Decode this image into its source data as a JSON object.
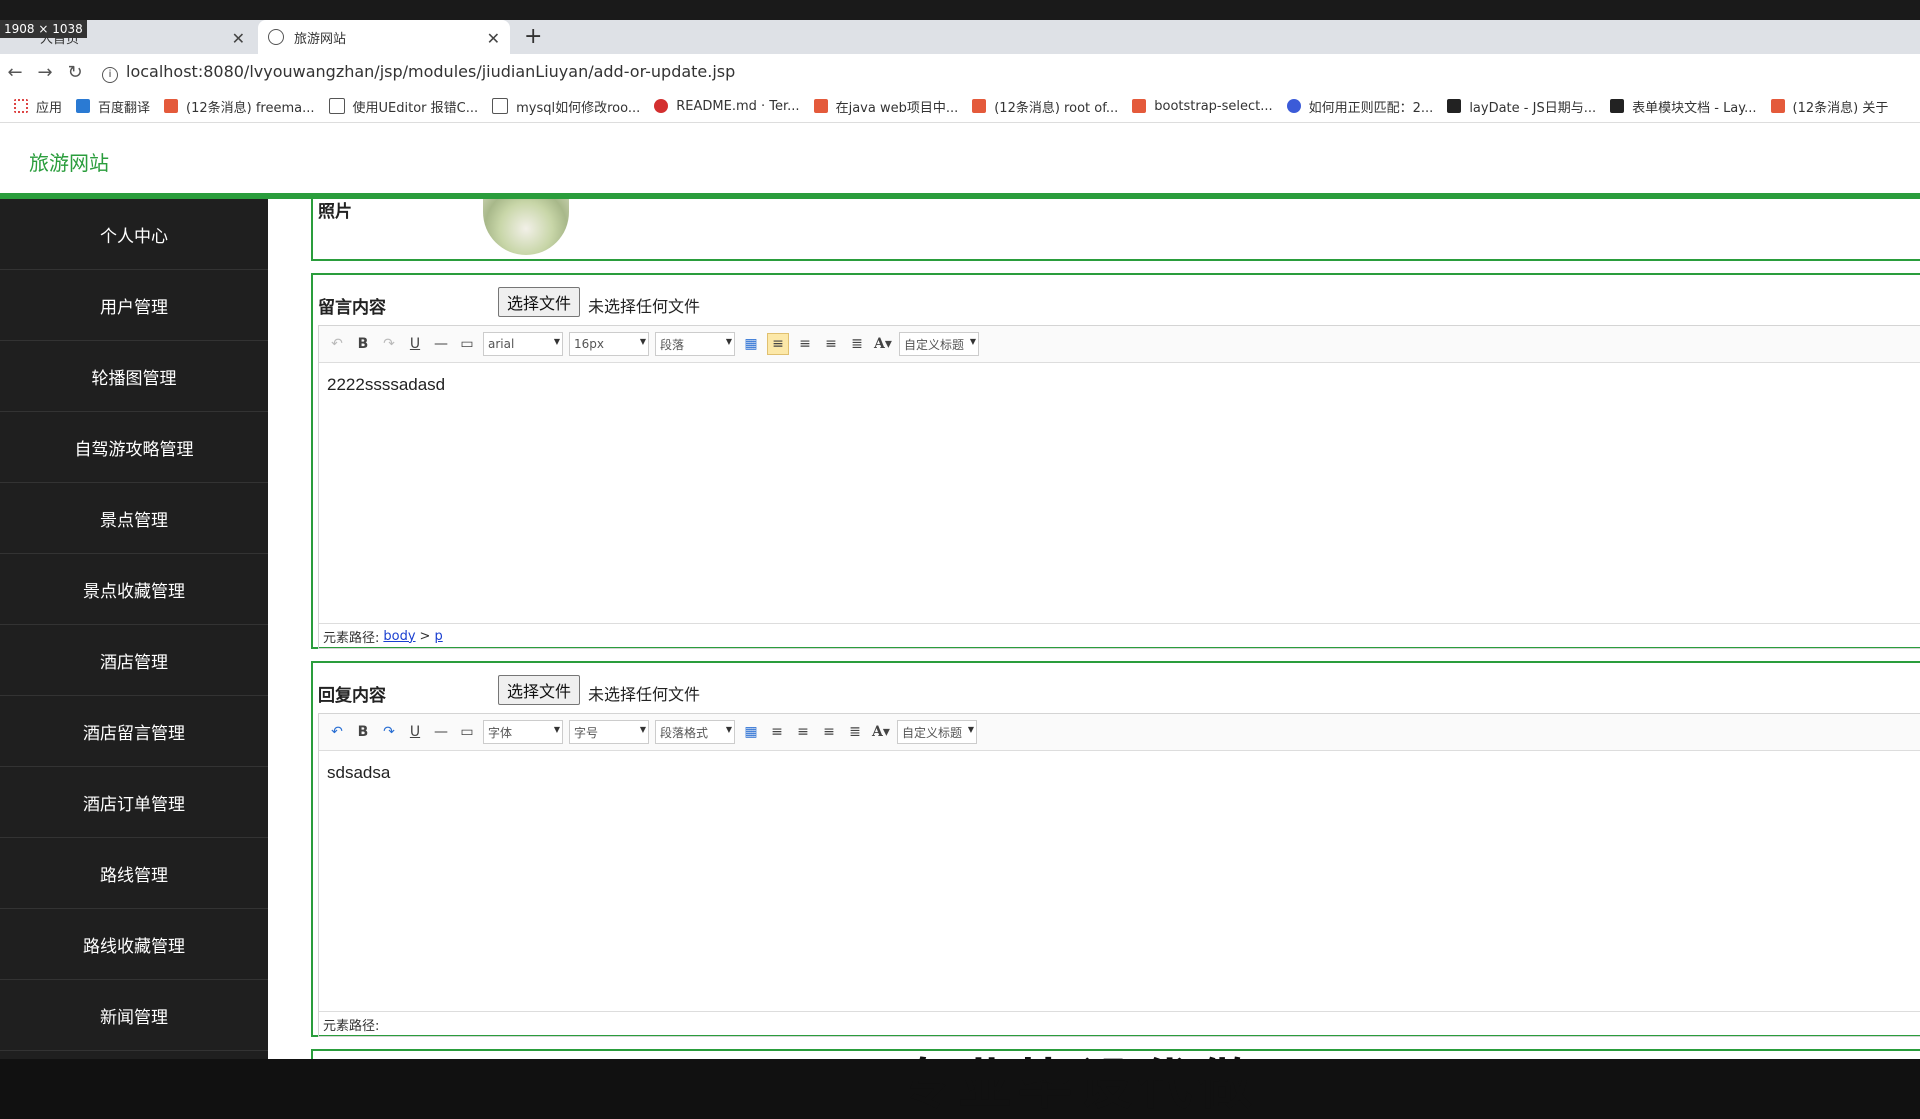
{
  "screen": {
    "size_badge": "1908 × 1038"
  },
  "browser": {
    "tabs": [
      {
        "label": "人首页"
      },
      {
        "label": "旅游网站"
      }
    ],
    "new_tab": "+",
    "url": "localhost:8080/lvyouwangzhan/jsp/modules/jiudianLiuyan/add-or-update.jsp",
    "bookmarks": [
      {
        "label": "应用"
      },
      {
        "label": "百度翻译"
      },
      {
        "label": "(12条消息) freema..."
      },
      {
        "label": "使用UEditor 报错C..."
      },
      {
        "label": "mysql如何修改roo..."
      },
      {
        "label": "README.md · Ter..."
      },
      {
        "label": "在java web项目中..."
      },
      {
        "label": "(12条消息) root of..."
      },
      {
        "label": "bootstrap-select..."
      },
      {
        "label": "如何用正则匹配：2..."
      },
      {
        "label": "layDate - JS日期与..."
      },
      {
        "label": "表单模块文档 - Lay..."
      },
      {
        "label": "(12条消息) 关于"
      }
    ]
  },
  "header": {
    "brand": "旅游网站"
  },
  "sidebar": {
    "items": [
      {
        "label": "个人中心"
      },
      {
        "label": "用户管理"
      },
      {
        "label": "轮播图管理"
      },
      {
        "label": "自驾游攻略管理"
      },
      {
        "label": "景点管理"
      },
      {
        "label": "景点收藏管理"
      },
      {
        "label": "酒店管理"
      },
      {
        "label": "酒店留言管理"
      },
      {
        "label": "酒店订单管理"
      },
      {
        "label": "路线管理"
      },
      {
        "label": "路线收藏管理"
      },
      {
        "label": "新闻管理"
      }
    ]
  },
  "form": {
    "photo_label": "照片",
    "message": {
      "label": "留言内容",
      "file_button": "选择文件",
      "file_status": "未选择任何文件",
      "toolbar": {
        "font": "arial",
        "size": "16px",
        "format": "段落",
        "custom": "自定义标题"
      },
      "content": "2222ssssadasd",
      "path_label": "元素路径:",
      "path_items": [
        "body",
        "p"
      ],
      "path_sep": ">"
    },
    "reply": {
      "label": "回复内容",
      "file_button": "选择文件",
      "file_status": "未选择任何文件",
      "toolbar": {
        "font": "字体",
        "size": "字号",
        "format": "段落格式",
        "custom": "自定义标题"
      },
      "content": "sdsadsa",
      "path_label": "元素路径:"
    }
  },
  "watermark": "专业毕设代做"
}
